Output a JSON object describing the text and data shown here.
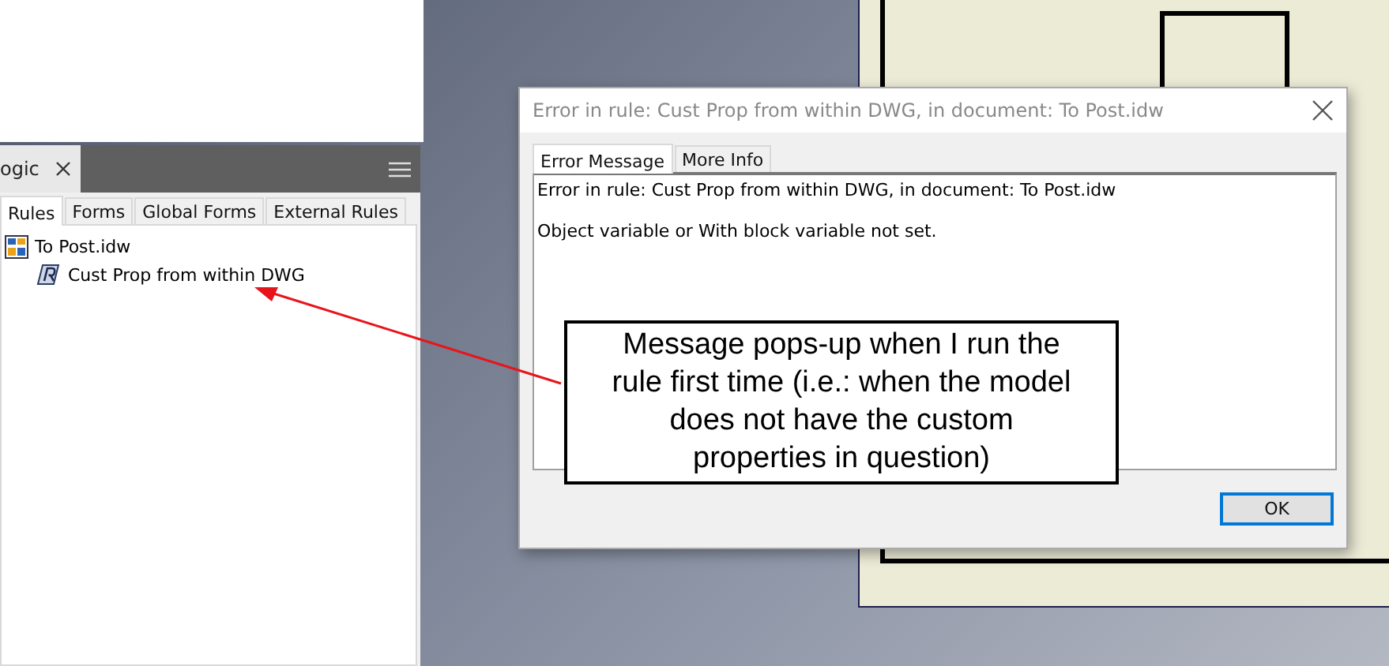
{
  "left_panel": {
    "title": "ogic",
    "tabs": [
      {
        "label": "Rules",
        "selected": true
      },
      {
        "label": "Forms",
        "selected": false
      },
      {
        "label": "Global Forms",
        "selected": false
      },
      {
        "label": "External Rules",
        "selected": false
      }
    ],
    "tree": [
      {
        "label": "To Post.idw",
        "kind": "document",
        "children": [
          {
            "label": "Cust Prop from within DWG",
            "kind": "rule"
          }
        ]
      }
    ]
  },
  "dialog": {
    "title": "Error in rule: Cust Prop from within DWG, in document: To Post.idw",
    "tabs": [
      {
        "label": "Error Message",
        "selected": true
      },
      {
        "label": "More Info",
        "selected": false
      }
    ],
    "message_lines": [
      "Error in rule: Cust Prop from within DWG, in document: To Post.idw",
      "Object variable or With block variable not set."
    ],
    "buttons": [
      {
        "label": "OK",
        "focused": true
      }
    ]
  },
  "callout": {
    "text": "Message pops-up when I run the rule first time (i.e.: when the model does not have the custom properties in question)"
  }
}
